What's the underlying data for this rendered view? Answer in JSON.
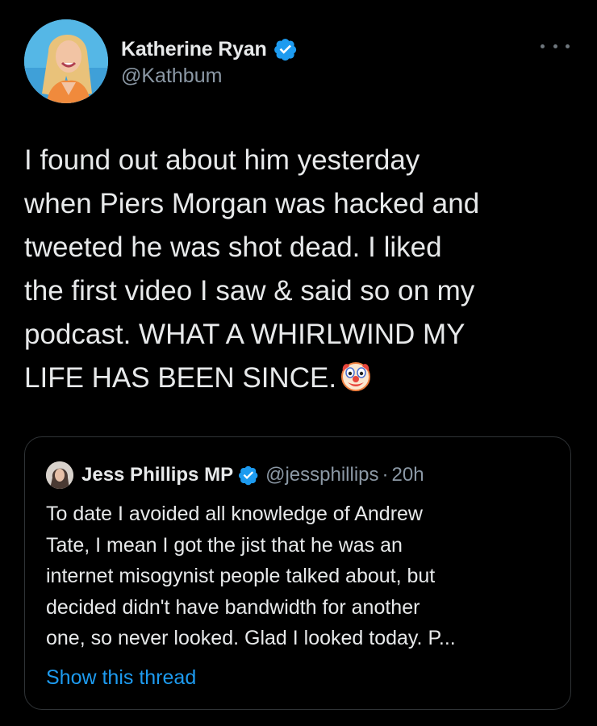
{
  "author": {
    "display_name": "Katherine Ryan",
    "handle": "@Kathbum",
    "verified_icon": "verified-badge-icon",
    "avatar_icon": "avatar-photo"
  },
  "more_menu": {
    "icon": "more-options-icon"
  },
  "tweet": {
    "text": "I found out about him yesterday\nwhen Piers Morgan was hacked and\ntweeted he was shot dead. I liked\nthe first video I saw & said so on my\npodcast. WHAT A WHIRLWIND MY\nLIFE HAS BEEN SINCE.",
    "emoji": "🤡",
    "emoji_icon": "clown-face-emoji"
  },
  "quoted_tweet": {
    "display_name": "Jess Phillips MP",
    "handle": "@jessphillips",
    "separator": "·",
    "time": "20h",
    "text": "To date I avoided all knowledge of Andrew\nTate, I mean I got the jist that he was an\ninternet misogynist people talked about, but\ndecided didn't have bandwidth for another\none, so never looked. Glad I looked today. P...",
    "link_label": "Show this thread"
  },
  "colors": {
    "background": "#000000",
    "text": "#e7e9ea",
    "secondary_text": "#8b98a5",
    "link": "#1d9bf0",
    "verified_badge": "#1d9bf0",
    "border": "#2f3336"
  }
}
